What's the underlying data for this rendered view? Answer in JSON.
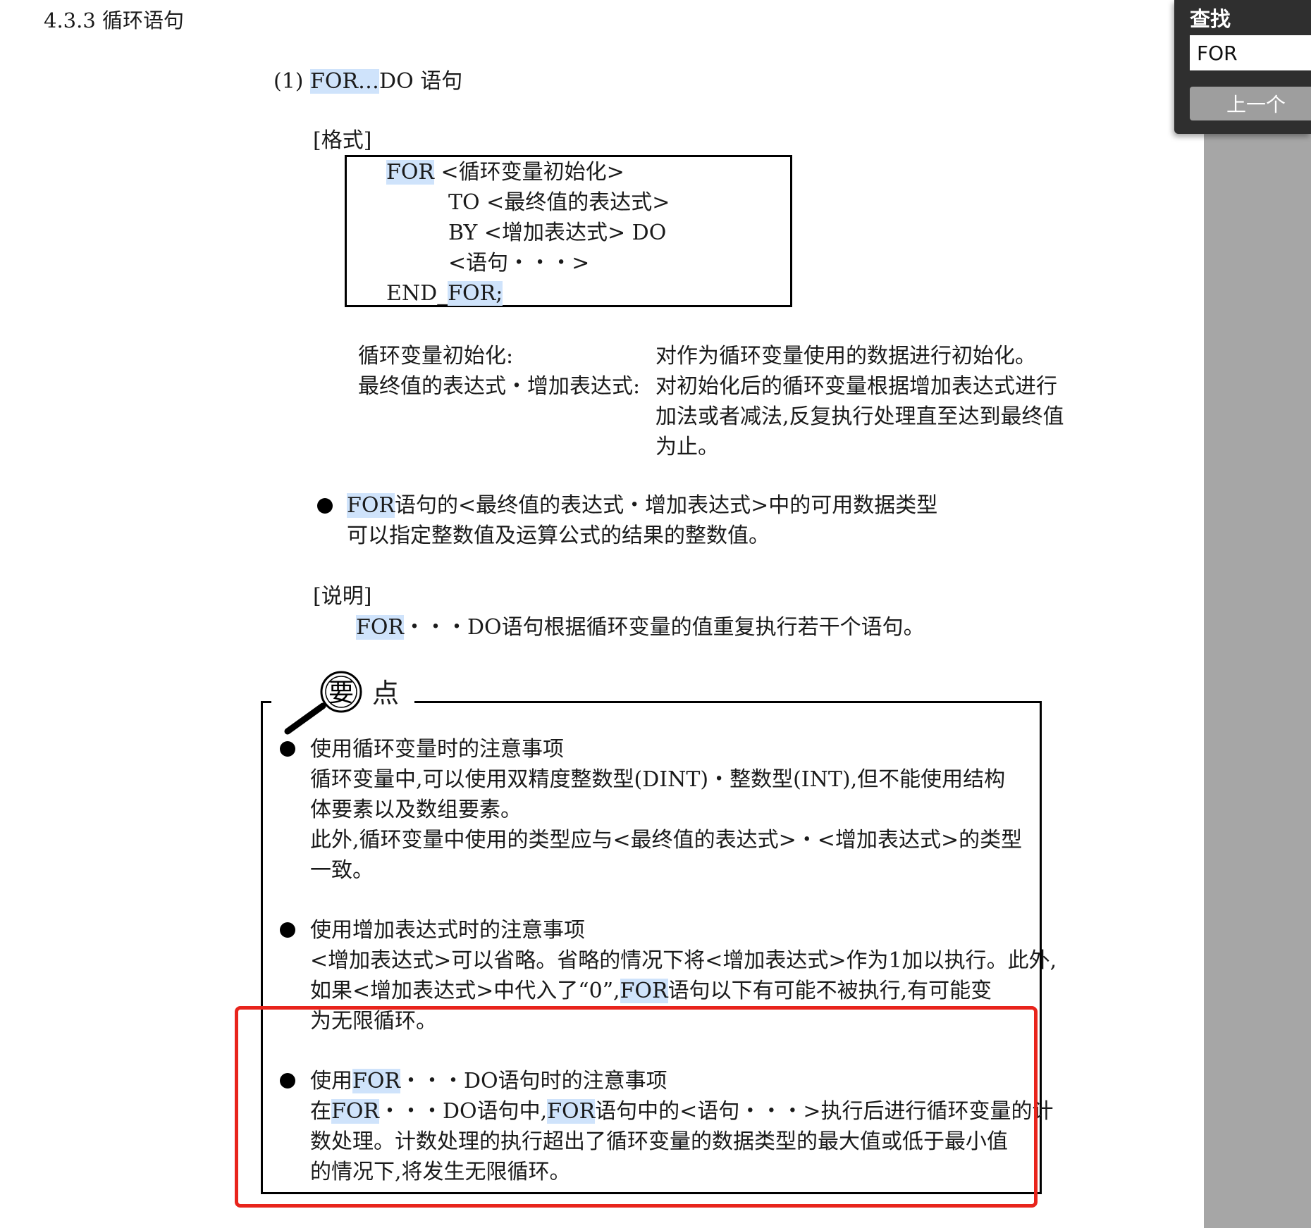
{
  "find": {
    "title": "查找",
    "query": "FOR",
    "prev_label": "上一个"
  },
  "doc": {
    "section_title": "4.3.3  循环语句",
    "subsection": {
      "num": "(1) ",
      "kw": "FOR…",
      "rest": "DO 语句"
    },
    "format_label": "[格式]",
    "syntax": {
      "line1_kw": "FOR",
      "line1_rest": " <循环变量初始化>",
      "line2": "TO <最终值的表达式>",
      "line3": "BY <增加表达式> DO",
      "line4": "<语句・・・>",
      "line5_pre": "END_",
      "line5_kw": "FOR;"
    },
    "defs": {
      "term1": "循环变量初始化:",
      "desc1": "对作为循环变量使用的数据进行初始化。",
      "term2": "最终值的表达式・增加表达式:",
      "desc2_l1": "对初始化后的循环变量根据增加表达式进行",
      "desc2_l2": "加法或者减法,反复执行处理直至达到最终值",
      "desc2_l3": "为止。"
    },
    "note": {
      "kw": "FOR",
      "l1_rest": "语句的<最终值的表达式・增加表达式>中的可用数据类型",
      "l2": "可以指定整数值及运算公式的结果的整数值。"
    },
    "explain_label": "[说明]",
    "explain": {
      "kw": "FOR",
      "rest": "・・・DO语句根据循环变量的值重复执行若干个语句。"
    },
    "points": {
      "magnifier_char": "要",
      "title": "点",
      "p1": {
        "heading": "使用循环变量时的注意事项",
        "l1": "循环变量中,可以使用双精度整数型(DINT)・整数型(INT),但不能使用结构",
        "l2": "体要素以及数组要素。",
        "l3": "此外,循环变量中使用的类型应与<最终值的表达式>・<增加表达式>的类型",
        "l4": "一致。"
      },
      "p2": {
        "heading": "使用增加表达式时的注意事项",
        "l1": "<增加表达式>可以省略。省略的情况下将<增加表达式>作为1加以执行。此外,",
        "l2_pre": "如果<增加表达式>中代入了“0”,",
        "l2_kw": "FOR",
        "l2_post": "语句以下有可能不被执行,有可能变",
        "l3": "为无限循环。"
      },
      "p3": {
        "heading_pre": "使用",
        "heading_kw": "FOR",
        "heading_post": "・・・DO语句时的注意事项",
        "l1_a": "在",
        "l1_kw1": "FOR",
        "l1_b": "・・・DO语句中,",
        "l1_kw2": "FOR",
        "l1_c": "语句中的<语句・・・>执行后进行循环变量的计",
        "l2": "数处理。计数处理的执行超出了循环变量的数据类型的最大值或低于最小值",
        "l3": "的情况下,将发生无限循环。"
      }
    }
  }
}
